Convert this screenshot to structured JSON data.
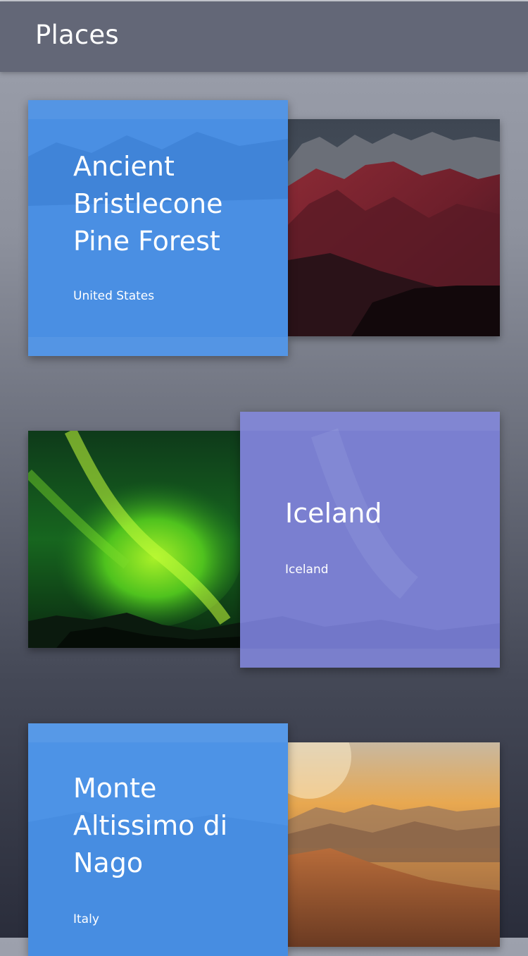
{
  "app_bar": {
    "title": "Places",
    "color": "#636777"
  },
  "places": [
    {
      "title": "Ancient Bristlecone Pine Forest",
      "subtitle": "United States",
      "panel_color": "#4a8fe3",
      "image": "red-mountains-photo"
    },
    {
      "title": "Iceland",
      "subtitle": "Iceland",
      "panel_color": "#7a7fd0",
      "image": "aurora-borealis-photo"
    },
    {
      "title": "Monte Altissimo di Nago",
      "subtitle": "Italy",
      "panel_color": "#4d93e6",
      "image": "sunset-hills-photo"
    }
  ]
}
